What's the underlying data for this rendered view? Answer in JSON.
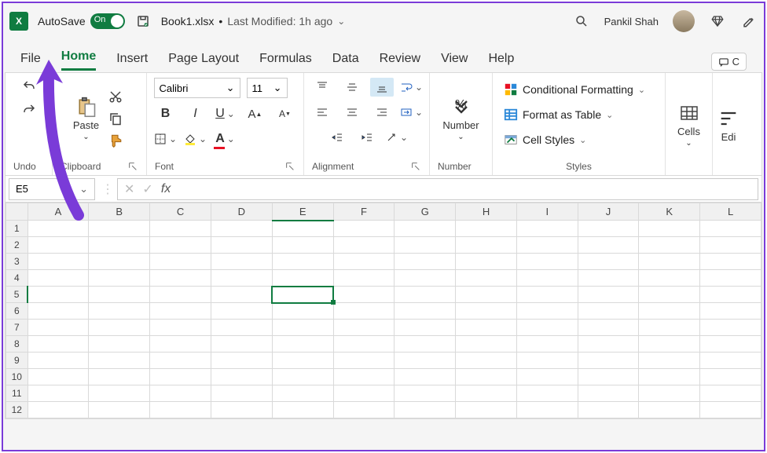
{
  "titlebar": {
    "autosave_label": "AutoSave",
    "autosave_on": "On",
    "filename": "Book1.xlsx",
    "modified": "Last Modified: 1h ago",
    "username": "Pankil Shah"
  },
  "tabs": [
    "File",
    "Home",
    "Insert",
    "Page Layout",
    "Formulas",
    "Data",
    "Review",
    "View",
    "Help"
  ],
  "active_tab": "Home",
  "comments_label": "C",
  "ribbon": {
    "undo": "Undo",
    "clipboard": "Clipboard",
    "paste": "Paste",
    "font_group": "Font",
    "font_name": "Calibri",
    "font_size": "11",
    "alignment": "Alignment",
    "number": "Number",
    "number_btn": "Number",
    "styles": "Styles",
    "cond_fmt": "Conditional Formatting",
    "fmt_table": "Format as Table",
    "cell_styles": "Cell Styles",
    "cells": "Cells",
    "editing": "Edi"
  },
  "namebox": "E5",
  "fx": "fx",
  "columns": [
    "A",
    "B",
    "C",
    "D",
    "E",
    "F",
    "G",
    "H",
    "I",
    "J",
    "K",
    "L"
  ],
  "rows": [
    1,
    2,
    3,
    4,
    5,
    6,
    7,
    8,
    9,
    10,
    11,
    12
  ],
  "selected": {
    "col": "E",
    "row": 5
  }
}
